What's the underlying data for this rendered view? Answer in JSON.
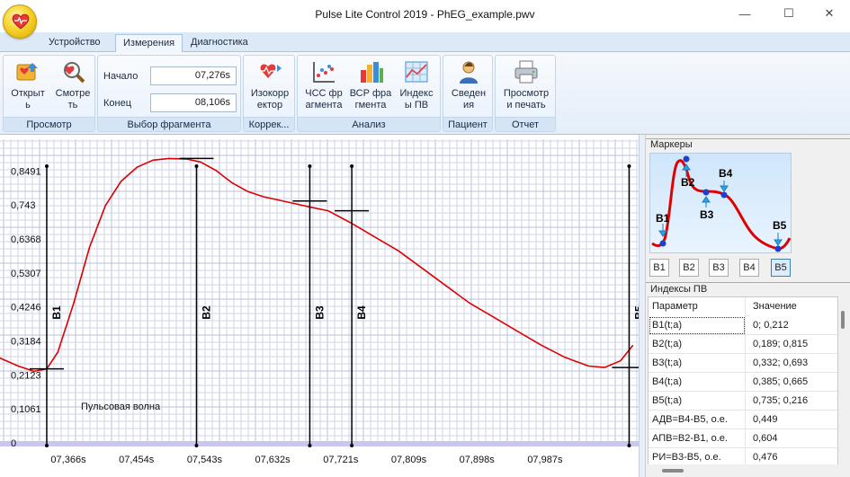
{
  "window": {
    "title": "Pulse Lite Control 2019 - PhEG_example.pwv",
    "minimize": "—",
    "maximize": "☐",
    "close": "✕"
  },
  "tabs": [
    {
      "label": "Устройство"
    },
    {
      "label": "Измерения",
      "active": true
    },
    {
      "label": "Диагностика"
    }
  ],
  "ribbon": {
    "view": {
      "label": "Просмотр",
      "open": "Открыт\nь",
      "watch": "Смотре\nть"
    },
    "fragment": {
      "label": "Выбор фрагмента",
      "start_label": "Начало",
      "start_value": "07,276s",
      "end_label": "Конец",
      "end_value": "08,106s"
    },
    "correction": {
      "label": "Коррек...",
      "isocorrector": "Изокорр\nектор"
    },
    "analysis": {
      "label": "Анализ",
      "hr_fragment": "ЧСС фр\nагмента",
      "hrv_fragment": "ВСР фра\nгмента",
      "pw_indices": "Индекс\nы ПВ"
    },
    "patient": {
      "label": "Пациент",
      "info": "Сведен\nия"
    },
    "report": {
      "label": "Отчет",
      "preview": "Просмотр\nи печать"
    }
  },
  "chart_data": {
    "type": "line",
    "y_ticks": [
      "0",
      "0,1061",
      "0,2123",
      "0,3184",
      "0,4246",
      "0,5307",
      "0,6368",
      "0,743",
      "0,8491"
    ],
    "x_ticks": [
      "07,366s",
      "07,454s",
      "07,543s",
      "07,632s",
      "07,721s",
      "07,809s",
      "07,898s",
      "07,987s"
    ],
    "series": [
      {
        "name": "Пульсовая волна",
        "color": "#dd0000",
        "x": [
          7.276,
          7.3,
          7.33,
          7.35,
          7.366,
          7.38,
          7.4,
          7.42,
          7.44,
          7.46,
          7.48,
          7.5,
          7.52,
          7.543,
          7.56,
          7.58,
          7.6,
          7.62,
          7.64,
          7.66,
          7.68,
          7.7,
          7.721,
          7.75,
          7.78,
          7.81,
          7.84,
          7.87,
          7.9,
          7.93,
          7.96,
          7.99,
          8.02,
          8.05,
          8.07,
          8.09,
          8.106
        ],
        "y": [
          0.28,
          0.25,
          0.22,
          0.205,
          0.212,
          0.26,
          0.4,
          0.56,
          0.68,
          0.75,
          0.79,
          0.81,
          0.815,
          0.813,
          0.805,
          0.78,
          0.745,
          0.72,
          0.705,
          0.695,
          0.685,
          0.675,
          0.665,
          0.63,
          0.59,
          0.55,
          0.5,
          0.45,
          0.4,
          0.36,
          0.32,
          0.28,
          0.245,
          0.22,
          0.216,
          0.235,
          0.28
        ]
      }
    ],
    "markers": [
      {
        "label": "B1",
        "x": 7.366,
        "y": 0.212
      },
      {
        "label": "B2",
        "x": 7.555,
        "y": 0.815
      },
      {
        "label": "B3",
        "x": 7.698,
        "y": 0.693
      },
      {
        "label": "B4",
        "x": 7.751,
        "y": 0.665
      },
      {
        "label": "B5",
        "x": 8.101,
        "y": 0.216
      }
    ],
    "xlim": [
      7.307,
      8.113
    ],
    "ylim": [
      0,
      0.87
    ],
    "grid": true,
    "annotation": "Пульсовая волна"
  },
  "markers_panel": {
    "title": "Маркеры",
    "illus_labels": [
      "B1",
      "B2",
      "B3",
      "B4",
      "B5"
    ],
    "buttons": [
      "B1",
      "B2",
      "B3",
      "B4",
      "B5"
    ],
    "selected": "B5"
  },
  "indices_panel": {
    "title": "Индексы ПВ",
    "header": {
      "param": "Параметр",
      "value": "Значение"
    },
    "rows": [
      {
        "param": "B1(t;a)",
        "value": "0; 0,212"
      },
      {
        "param": "B2(t;a)",
        "value": "0,189; 0,815"
      },
      {
        "param": "B3(t;a)",
        "value": "0,332; 0,693"
      },
      {
        "param": "B4(t;a)",
        "value": "0,385; 0,665"
      },
      {
        "param": "B5(t;a)",
        "value": "0,735; 0,216"
      },
      {
        "param": "АДВ=B4-B5, о.е.",
        "value": "0,449"
      },
      {
        "param": "АПВ=B2-B1, о.е.",
        "value": "0,604"
      },
      {
        "param": "РИ=B3-B5, о.е.",
        "value": "0,476"
      }
    ]
  },
  "colors": {
    "accent": "#dd0000",
    "grid_minor": "#cfd6ea",
    "grid_major": "#b6c0df",
    "ribbon_bg": "#e4eef9"
  }
}
